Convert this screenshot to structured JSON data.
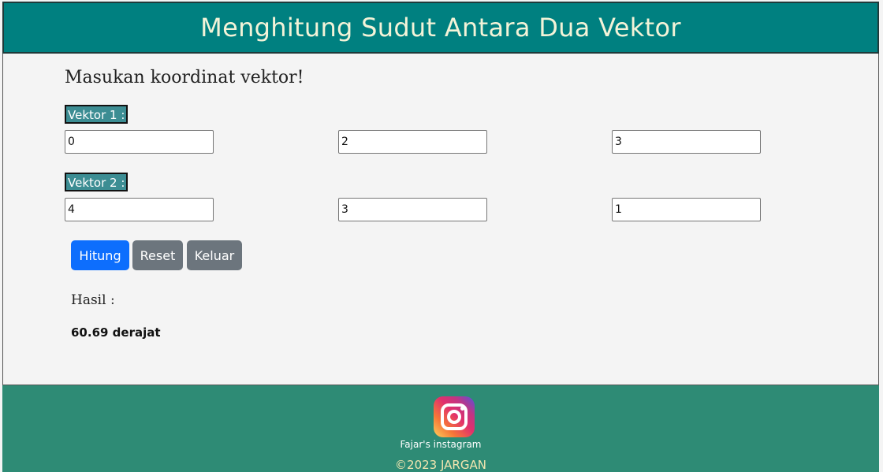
{
  "header": {
    "title": "Menghitung Sudut Antara Dua Vektor"
  },
  "form": {
    "prompt": "Masukan koordinat vektor!",
    "vektor1": {
      "label": "Vektor 1 :",
      "x": "0",
      "y": "2",
      "z": "3"
    },
    "vektor2": {
      "label": "Vektor 2 :",
      "x": "4",
      "y": "3",
      "z": "1"
    }
  },
  "buttons": {
    "hitung": "Hitung",
    "reset": "Reset",
    "keluar": "Keluar"
  },
  "result": {
    "label": "Hasil :",
    "value": "60.69 derajat"
  },
  "footer": {
    "instagram_icon": "instagram-icon",
    "instagram_caption": "Fajar's instagram",
    "copyright": "©2023 JARGAN"
  },
  "colors": {
    "header_bg": "#008080",
    "label_bg": "#3c8d93",
    "primary": "#0d6efd",
    "secondary": "#6c757d",
    "footer_bg": "#2e8b75"
  }
}
